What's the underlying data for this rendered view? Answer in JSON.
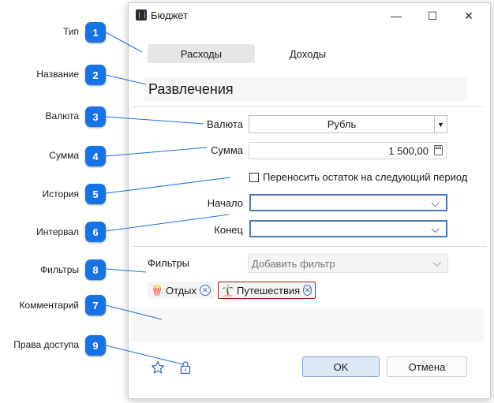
{
  "window": {
    "title": "Бюджет"
  },
  "titlebar": {
    "minimize": "—",
    "maximize": "☐",
    "close": "✕"
  },
  "type_tabs": [
    {
      "label": "Расходы",
      "active": true
    },
    {
      "label": "Доходы",
      "active": false
    }
  ],
  "name_value": "Развлечения",
  "currency": {
    "label": "Валюта",
    "value": "Рубль"
  },
  "amount": {
    "label": "Сумма",
    "value": "1 500,00"
  },
  "carryover": {
    "label": "Переносить остаток на следующий период",
    "checked": false
  },
  "start": {
    "label": "Начало",
    "value": ""
  },
  "end": {
    "label": "Конец",
    "value": ""
  },
  "filters": {
    "label": "Фильтры",
    "placeholder": "Добавить фильтр",
    "tags": [
      {
        "label": "Отдых",
        "icon": "popcorn-icon"
      },
      {
        "label": "Путешествия",
        "icon": "palm-tree-icon"
      }
    ]
  },
  "comment": "",
  "buttons": {
    "ok": "OK",
    "cancel": "Отмена"
  },
  "callouts": [
    {
      "num": "1",
      "label": "Тип"
    },
    {
      "num": "2",
      "label": "Название"
    },
    {
      "num": "3",
      "label": "Валюта"
    },
    {
      "num": "4",
      "label": "Сумма"
    },
    {
      "num": "5",
      "label": "История"
    },
    {
      "num": "6",
      "label": "Интервал"
    },
    {
      "num": "8",
      "label": "Фильтры"
    },
    {
      "num": "7",
      "label": "Комментарий"
    },
    {
      "num": "9",
      "label": "Права доступа"
    }
  ],
  "colors": {
    "badge": "#1573e6",
    "accent": "#3a6fb0",
    "active_tab": "#e6e6e6"
  }
}
